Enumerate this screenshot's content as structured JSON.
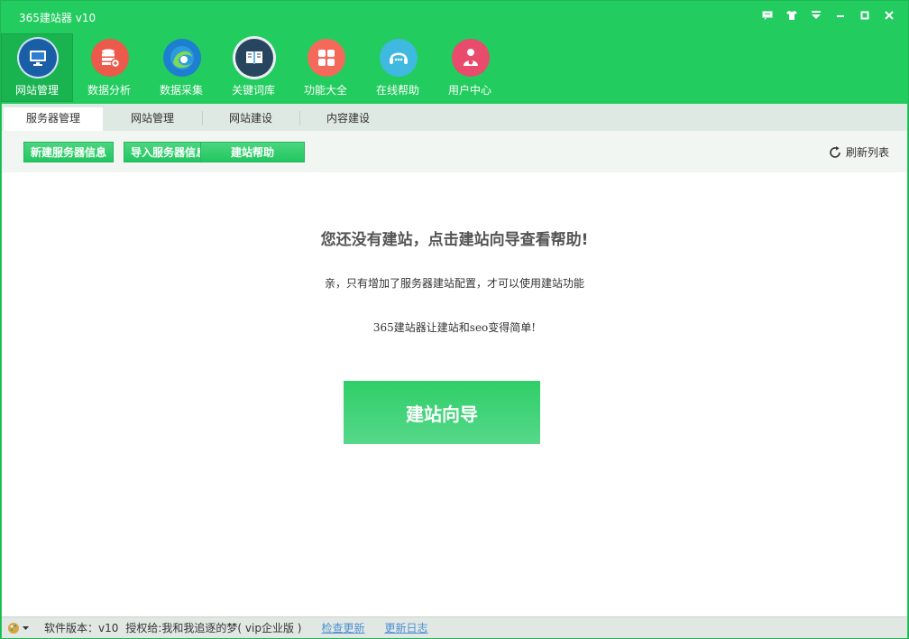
{
  "window": {
    "title": "365建站器 v10"
  },
  "colors": {
    "brand": "#22cc5e",
    "active_tool": "#19b350",
    "link": "#4d8fd1"
  },
  "window_controls": [
    {
      "name": "message-icon",
      "glyph": "▪"
    },
    {
      "name": "skin-icon",
      "glyph": "♦"
    },
    {
      "name": "menu-icon",
      "glyph": "▼"
    },
    {
      "name": "minimize-icon",
      "glyph": "—"
    },
    {
      "name": "maximize-icon",
      "glyph": "▢"
    },
    {
      "name": "close-icon",
      "glyph": "✕"
    }
  ],
  "toolbar": [
    {
      "label": "网站管理",
      "icon": "monitor-icon",
      "active": true
    },
    {
      "label": "数据分析",
      "icon": "database-icon",
      "active": false
    },
    {
      "label": "数据采集",
      "icon": "browser-icon",
      "active": false
    },
    {
      "label": "关键词库",
      "icon": "book-icon",
      "active": false
    },
    {
      "label": "功能大全",
      "icon": "grid-icon",
      "active": false
    },
    {
      "label": "在线帮助",
      "icon": "headset-icon",
      "active": false
    },
    {
      "label": "用户中心",
      "icon": "user-icon",
      "active": false
    }
  ],
  "tabs": [
    {
      "label": "服务器管理",
      "active": true
    },
    {
      "label": "网站管理",
      "active": false
    },
    {
      "label": "网站建设",
      "active": false
    },
    {
      "label": "内容建设",
      "active": false
    }
  ],
  "actions": {
    "new_server": "新建服务器信息",
    "import_server": "导入服务器信息",
    "help": "建站帮助",
    "refresh": "刷新列表"
  },
  "main": {
    "headline": "您还没有建站，点击建站向导查看帮助!",
    "sub1": "亲，只有增加了服务器建站配置，才可以使用建站功能",
    "sub2": "365建站器让建站和seo变得简单!",
    "wizard_button": "建站向导"
  },
  "status": {
    "version": "软件版本：v10",
    "licensed": "授权给:我和我追逐的梦( vip企业版 )",
    "check_update": "检查更新",
    "changelog": "更新日志"
  }
}
